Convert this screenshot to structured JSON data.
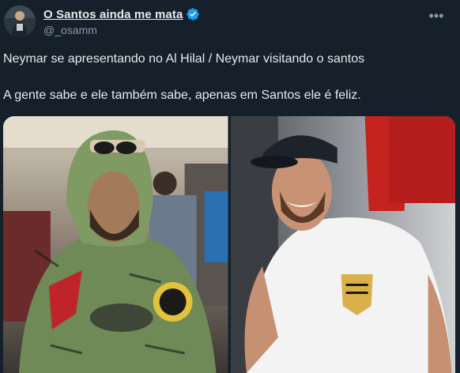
{
  "tweet": {
    "display_name": "O Santos ainda me mata",
    "handle": "@_osamm",
    "verified": true,
    "more_icon": "more-horizontal-icon",
    "text_line_1": "Neymar se apresentando no Al Hilal / Neymar visitando o santos",
    "text_line_2": "A gente sabe e ele também sabe, apenas em Santos ele é feliz."
  },
  "media": {
    "images": [
      {
        "name": "photo-left",
        "alt": ""
      },
      {
        "name": "photo-right",
        "alt": ""
      }
    ]
  },
  "colors": {
    "background": "#15202b",
    "text": "#e7e9ea",
    "muted": "#8b98a5",
    "verified": "#1d9bf0"
  }
}
